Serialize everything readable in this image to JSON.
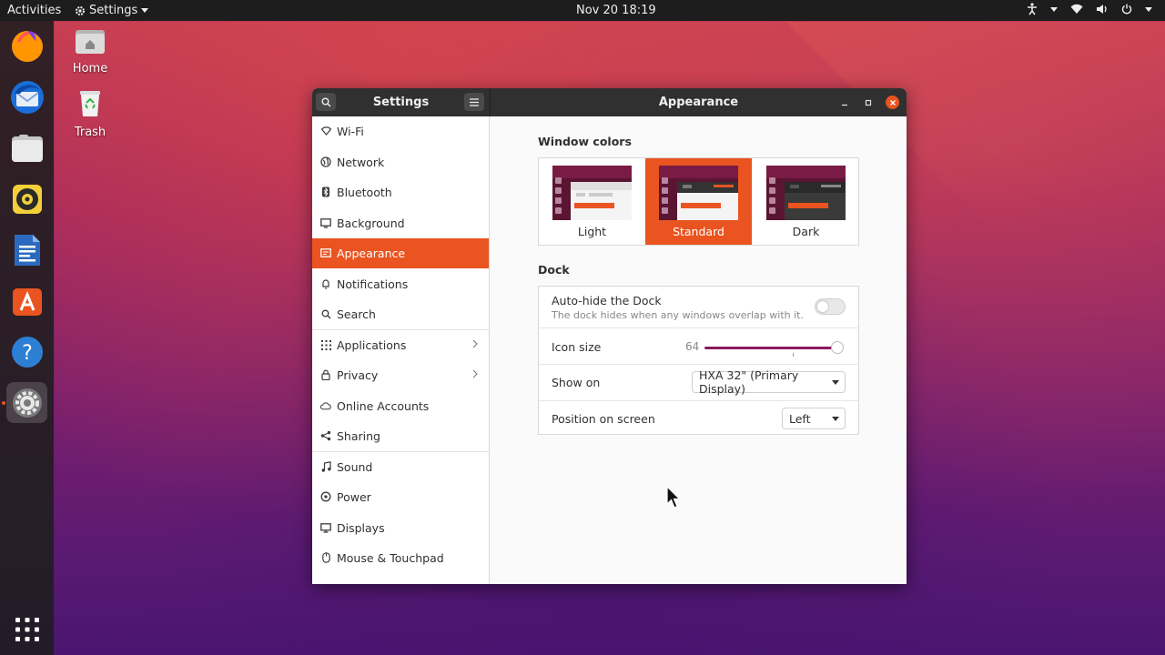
{
  "topbar": {
    "activities": "Activities",
    "app_menu": "Settings",
    "clock": "Nov 20  18:19",
    "tray_icons": [
      "accessibility-icon",
      "chevron-down-icon",
      "wifi-icon",
      "volume-icon",
      "power-icon",
      "chevron-down-icon"
    ]
  },
  "dock": {
    "apps": [
      {
        "name": "firefox-icon"
      },
      {
        "name": "thunderbird-icon"
      },
      {
        "name": "files-icon"
      },
      {
        "name": "rhythmbox-icon"
      },
      {
        "name": "libreoffice-writer-icon"
      },
      {
        "name": "ubuntu-software-icon"
      },
      {
        "name": "help-icon"
      },
      {
        "name": "settings-icon",
        "active": true
      }
    ],
    "show_apps": "show-applications-icon"
  },
  "desktop": {
    "home_label": "Home",
    "trash_label": "Trash"
  },
  "window": {
    "left_title": "Settings",
    "right_title": "Appearance"
  },
  "sidebar": {
    "items": [
      {
        "label": "Wi-Fi",
        "icon": "wifi-icon"
      },
      {
        "label": "Network",
        "icon": "network-icon"
      },
      {
        "label": "Bluetooth",
        "icon": "bluetooth-icon"
      },
      {
        "label": "Background",
        "icon": "background-icon"
      },
      {
        "label": "Appearance",
        "icon": "appearance-icon",
        "selected": true
      },
      {
        "label": "Notifications",
        "icon": "bell-icon"
      },
      {
        "label": "Search",
        "icon": "search-icon"
      },
      {
        "label": "Applications",
        "icon": "grid-icon",
        "chevron": true
      },
      {
        "label": "Privacy",
        "icon": "lock-icon",
        "chevron": true
      },
      {
        "label": "Online Accounts",
        "icon": "cloud-icon"
      },
      {
        "label": "Sharing",
        "icon": "share-icon"
      },
      {
        "label": "Sound",
        "icon": "music-note-icon"
      },
      {
        "label": "Power",
        "icon": "power-icon"
      },
      {
        "label": "Displays",
        "icon": "display-icon"
      },
      {
        "label": "Mouse & Touchpad",
        "icon": "mouse-icon"
      }
    ]
  },
  "appearance": {
    "window_colors_title": "Window colors",
    "themes": [
      {
        "label": "Light",
        "selected": false
      },
      {
        "label": "Standard",
        "selected": true
      },
      {
        "label": "Dark",
        "selected": false
      }
    ],
    "dock_title": "Dock",
    "autohide": {
      "label": "Auto-hide the Dock",
      "sub": "The dock hides when any windows overlap with it.",
      "on": false
    },
    "icon_size": {
      "label": "Icon size",
      "value": "64",
      "fraction": 1.0
    },
    "show_on": {
      "label": "Show on",
      "value": "HXA 32\" (Primary Display)"
    },
    "position": {
      "label": "Position on screen",
      "value": "Left"
    }
  },
  "colors": {
    "accent": "#e95420",
    "slider": "#8b1a5e"
  }
}
